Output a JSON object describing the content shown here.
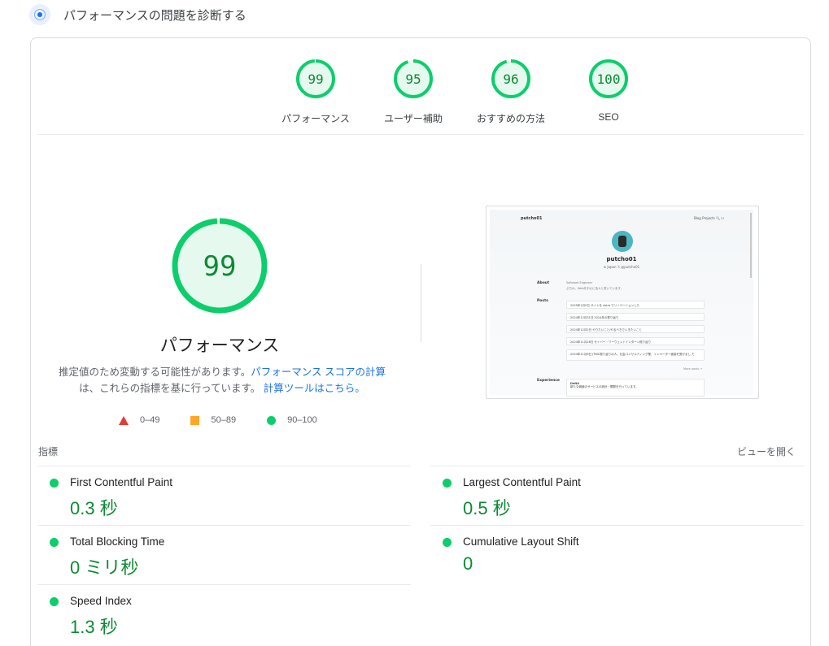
{
  "header": {
    "title": "パフォーマンスの問題を診断する"
  },
  "categories": [
    {
      "score": 99,
      "label": "パフォーマンス"
    },
    {
      "score": 95,
      "label": "ユーザー補助"
    },
    {
      "score": 96,
      "label": "おすすめの方法"
    },
    {
      "score": 100,
      "label": "SEO"
    }
  ],
  "main": {
    "score": 99,
    "label": "パフォーマンス",
    "desc_1": "推定値のため変動する可能性があります。",
    "desc_link_1": "パフォーマンス スコアの計算",
    "desc_2": "は、これらの指標を基に行っています。",
    "desc_link_2": "計算ツールはこちら。"
  },
  "legend": {
    "fail": "0–49",
    "average": "50–89",
    "pass": "90–100"
  },
  "colors": {
    "pass": "#0cce6b",
    "pass_text": "#0d8a34",
    "average": "#ffa726",
    "fail": "#e53935",
    "link": "#1a73e8"
  },
  "thumbnail": {
    "brand": "putcho01",
    "nav": "Blog   Projects   🔍   ☐",
    "name": "putcho01",
    "sub": "⊕ Japan    𝕏 @putcho01",
    "about_heading": "About",
    "about_text_1": "Software Engineer",
    "about_text_2": "ぷちわ。Webを中心に色々と書いています。",
    "posts_heading": "Posts",
    "posts": [
      "2025年1月9日   サイトを Astro でリノベーションした",
      "2024年12月31日 2024年の振り返り",
      "2024年12月2日  やりたいこと/やるべきでいきたいこと",
      "2024年11月28日 セイバー・ワーウェントインターン振り返り",
      "2024年11月6日  JTBIC振り返りの人、社会コンサルティング業、インペーター面接を受けまし た"
    ],
    "more": "More posts →",
    "experience_heading": "Experience",
    "exp_title": "DeNA",
    "exp_text": "新たな価値のサービスの設計・開発を行っています。"
  },
  "metrics": {
    "label": "指標",
    "expand": "ビューを開く",
    "items": [
      {
        "title": "First Contentful Paint",
        "value": "0.3 秒"
      },
      {
        "title": "Largest Contentful Paint",
        "value": "0.5 秒"
      },
      {
        "title": "Total Blocking Time",
        "value": "0 ミリ秒"
      },
      {
        "title": "Cumulative Layout Shift",
        "value": "0"
      },
      {
        "title": "Speed Index",
        "value": "1.3 秒"
      }
    ]
  }
}
